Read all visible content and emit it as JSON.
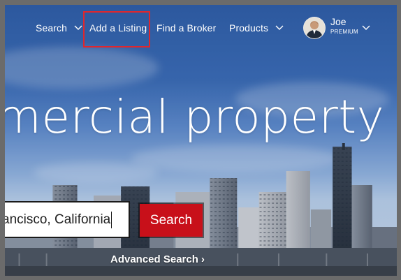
{
  "nav": {
    "search_label": "Search",
    "add_listing_label": "Add a Listing",
    "find_broker_label": "Find a Broker",
    "products_label": "Products"
  },
  "user": {
    "name": "Joe",
    "tier": "PREMIUM"
  },
  "hero": {
    "headline": "ommercial property"
  },
  "search": {
    "input_value": "ancisco, California",
    "button_label": "Search",
    "advanced_label": "Advanced Search ›"
  },
  "colors": {
    "accent_red": "#c8101a",
    "highlight_box": "#e0262d",
    "frame_gray": "#6b6b6b"
  },
  "icons": [
    "chevron-down-icon",
    "avatar-photo"
  ]
}
